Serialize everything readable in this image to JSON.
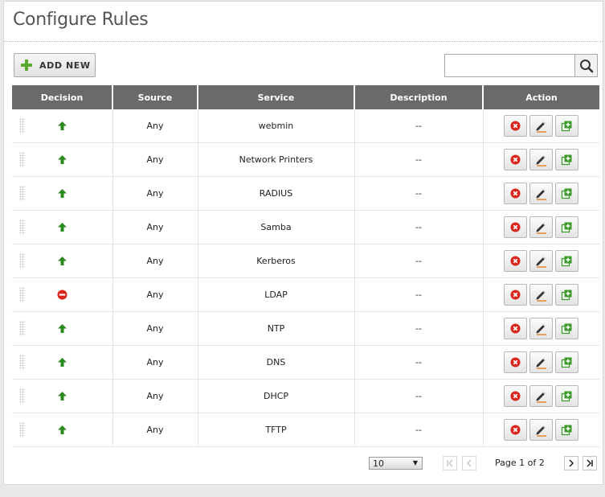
{
  "page": {
    "title": "Configure Rules"
  },
  "toolbar": {
    "add_label": "ADD NEW",
    "search_value": ""
  },
  "table": {
    "headers": [
      "Decision",
      "Source",
      "Service",
      "Description",
      "Action"
    ],
    "rows": [
      {
        "decision": "accept",
        "source": "Any",
        "service": "webmin",
        "description": "--"
      },
      {
        "decision": "accept",
        "source": "Any",
        "service": "Network Printers",
        "description": "--"
      },
      {
        "decision": "accept",
        "source": "Any",
        "service": "RADIUS",
        "description": "--"
      },
      {
        "decision": "accept",
        "source": "Any",
        "service": "Samba",
        "description": "--"
      },
      {
        "decision": "accept",
        "source": "Any",
        "service": "Kerberos",
        "description": "--"
      },
      {
        "decision": "deny",
        "source": "Any",
        "service": "LDAP",
        "description": "--"
      },
      {
        "decision": "accept",
        "source": "Any",
        "service": "NTP",
        "description": "--"
      },
      {
        "decision": "accept",
        "source": "Any",
        "service": "DNS",
        "description": "--"
      },
      {
        "decision": "accept",
        "source": "Any",
        "service": "DHCP",
        "description": "--"
      },
      {
        "decision": "accept",
        "source": "Any",
        "service": "TFTP",
        "description": "--"
      }
    ]
  },
  "pager": {
    "page_size": "10",
    "page_label": "Page 1 of 2"
  },
  "colors": {
    "header_bg": "#6a6a6a",
    "accept": "#2a8a1e",
    "deny": "#d9251c",
    "copy": "#3c9a2a",
    "edit_underline": "#e07a10"
  },
  "icons": {
    "accept": "arrow-up-icon",
    "deny": "no-entry-icon",
    "delete": "delete-icon",
    "edit": "pencil-icon",
    "copy": "copy-icon",
    "search": "search-icon",
    "add": "plus-icon"
  }
}
